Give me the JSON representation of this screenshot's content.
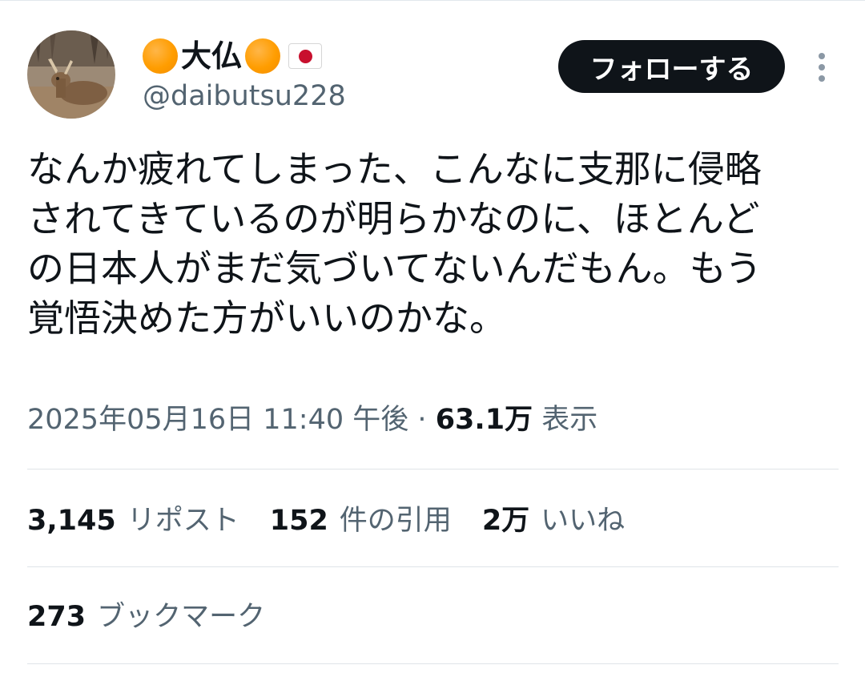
{
  "colors": {
    "text_primary": "#0f1419",
    "text_secondary": "#536471",
    "follow_button_bg": "#0f1419",
    "divider": "#dfe4e8",
    "orange_dot": "#ff9d00",
    "flag_red": "#c8102e"
  },
  "icons": {
    "avatar": "deer-photo-avatar",
    "name_prefix": "orange-circle-emoji",
    "name_suffix": "orange-circle-emoji",
    "flag": "japan-flag-emoji",
    "more": "vertical-ellipsis-icon"
  },
  "user": {
    "display_name": "大仏",
    "handle": "@daibutsu228"
  },
  "header": {
    "follow_label": "フォローする"
  },
  "tweet": {
    "lines": [
      "なんか疲れてしまった、こんなに支那に侵略",
      "されてきているのが明らかなのに、ほとんど",
      "の日本人がまだ気づいてないんだもん。もう",
      "覚悟決めた方がいいのかな。"
    ]
  },
  "meta": {
    "timestamp": "2025年05月16日 11:40 午後",
    "separator": "·",
    "views_count": "63.1万",
    "views_label": "表示"
  },
  "stats": {
    "reposts_count": "3,145",
    "reposts_label": "リポスト",
    "quotes_count": "152",
    "quotes_label": "件の引用",
    "likes_count": "2万",
    "likes_label": "いいね",
    "bookmarks_count": "273",
    "bookmarks_label": "ブックマーク"
  }
}
